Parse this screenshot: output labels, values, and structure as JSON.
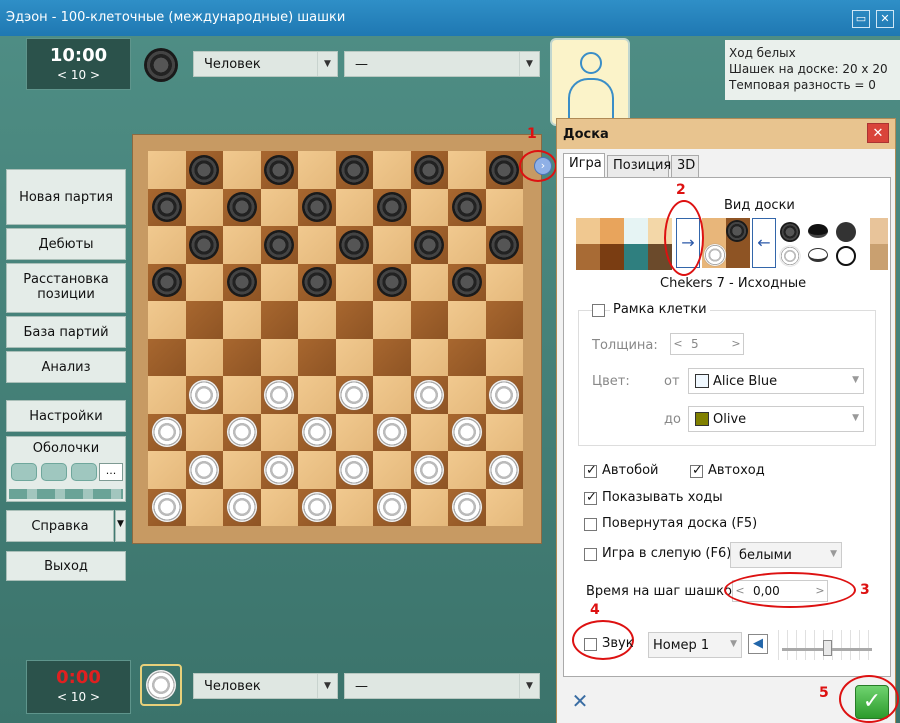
{
  "window": {
    "title": "Эдэон - 100-клеточные (международные) шашки",
    "minimize": "▭",
    "close": "✕"
  },
  "top_clock": {
    "time": "10:00",
    "sub": "< 10 >"
  },
  "bottom_clock": {
    "time": "0:00",
    "sub": "< 10 >"
  },
  "top_player": {
    "type": "Человек",
    "level": "—",
    "piece": "black-piece-icon"
  },
  "bottom_player": {
    "type": "Человек",
    "level": "—",
    "piece": "white-piece-icon"
  },
  "sidebar": {
    "new_game": "Новая партия",
    "openings": "Дебюты",
    "setup_1": "Расстановка",
    "setup_2": "позиции",
    "game_base": "База партий",
    "analysis": "Анализ",
    "settings": "Настройки",
    "shells": "Оболочки",
    "shells_more": "...",
    "help": "Справка",
    "exit": "Выход"
  },
  "info": {
    "line1": "Ход белых",
    "line2": "Шашек на доске: 20 х 20",
    "line3": "Темповая разность = 0"
  },
  "markers": {
    "m1": "1",
    "m2": "2",
    "m3": "3",
    "m4": "4",
    "m5": "5"
  },
  "dialog": {
    "title": "Доска",
    "close": "✕",
    "tabs": [
      "Игра",
      "Позиция",
      "3D"
    ],
    "board_view": "Вид доски",
    "board_name": "Chekers 7 - Исходные",
    "cell_frame": "Рамка клетки",
    "thickness_label": "Толщина:",
    "thickness_value": "5",
    "color_label": "Цвет:",
    "from_label": "от",
    "to_label": "до",
    "color_from": "Alice Blue",
    "color_to": "Olive",
    "color_from_hex": "#f0f8ff",
    "color_to_hex": "#808000",
    "autobeat": "Автобой",
    "automove": "Автоход",
    "show_moves": "Показывать ходы",
    "rotated_board": "Повернутая доска (F5)",
    "blind_game": "Игра в слепую (F6)",
    "blind_side": "белыми",
    "step_time_label": "Время на шаг шашкой",
    "step_time_value": "0,00",
    "sound": "Звук",
    "sound_number": "Номер 1",
    "volume_level": 0.5
  },
  "colors": {
    "accent_red": "#dd1111",
    "dialog_title": "#e8c48f",
    "board_light": "#f1c98f",
    "board_dark": "#a8672f"
  }
}
